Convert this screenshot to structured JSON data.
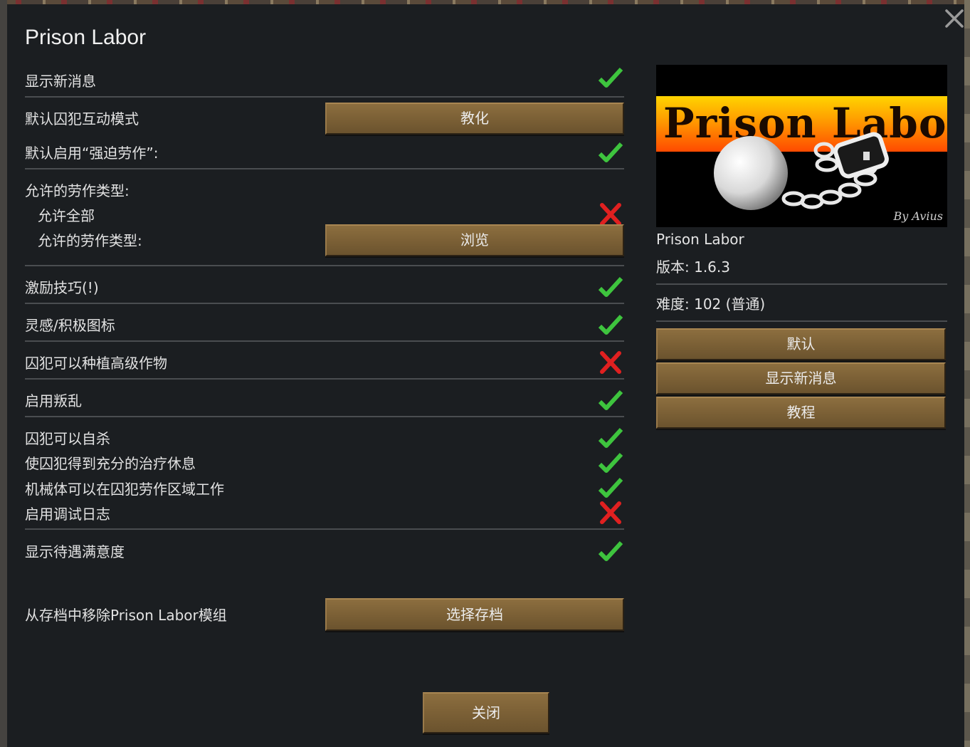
{
  "window": {
    "title": "Prison Labor"
  },
  "settings": {
    "show_news": {
      "label": "显示新消息",
      "enabled": true
    },
    "default_interaction": {
      "label": "默认囚犯互动模式",
      "button": "教化"
    },
    "default_forced_labor": {
      "label": "默认启用“强迫劳作”:",
      "enabled": true
    },
    "allowed_work_types": {
      "label": "允许的劳作类型:"
    },
    "allow_all": {
      "label": "允许全部",
      "enabled": false
    },
    "allowed_types_browse": {
      "label": "允许的劳作类型:",
      "button": "浏览"
    },
    "motivation": {
      "label": "激励技巧(!)",
      "enabled": true
    },
    "inspiration_icon": {
      "label": "灵感/积极图标",
      "enabled": true
    },
    "advanced_crops": {
      "label": "囚犯可以种植高级作物",
      "enabled": false
    },
    "enable_revolts": {
      "label": "启用叛乱",
      "enabled": true
    },
    "suicide": {
      "label": "囚犯可以自杀",
      "enabled": true
    },
    "treatment_rest": {
      "label": "使囚犯得到充分的治疗休息",
      "enabled": true
    },
    "mechanoids_work": {
      "label": "机械体可以在囚犯劳作区域工作",
      "enabled": true
    },
    "debug_log": {
      "label": "启用调试日志",
      "enabled": false
    },
    "treatment_satisfaction": {
      "label": "显示待遇满意度",
      "enabled": true
    },
    "remove_mod": {
      "label": "从存档中移除Prison Labor模组",
      "button": "选择存档"
    }
  },
  "mod_info": {
    "preview_title": "Prison Labor",
    "preview_byline": "By Avius",
    "name": "Prison Labor",
    "version": "版本: 1.6.3",
    "difficulty": "难度: 102 (普通)"
  },
  "side_buttons": {
    "default": "默认",
    "show_news": "显示新消息",
    "tutorial": "教程"
  },
  "footer": {
    "close": "关闭"
  },
  "colors": {
    "check": "#3ec43e",
    "cross": "#e02020",
    "button": "#7a5f35",
    "window_bg": "#1b1e21"
  },
  "icons": {
    "check": "checkmark-icon",
    "cross": "cross-icon",
    "close": "close-icon"
  }
}
